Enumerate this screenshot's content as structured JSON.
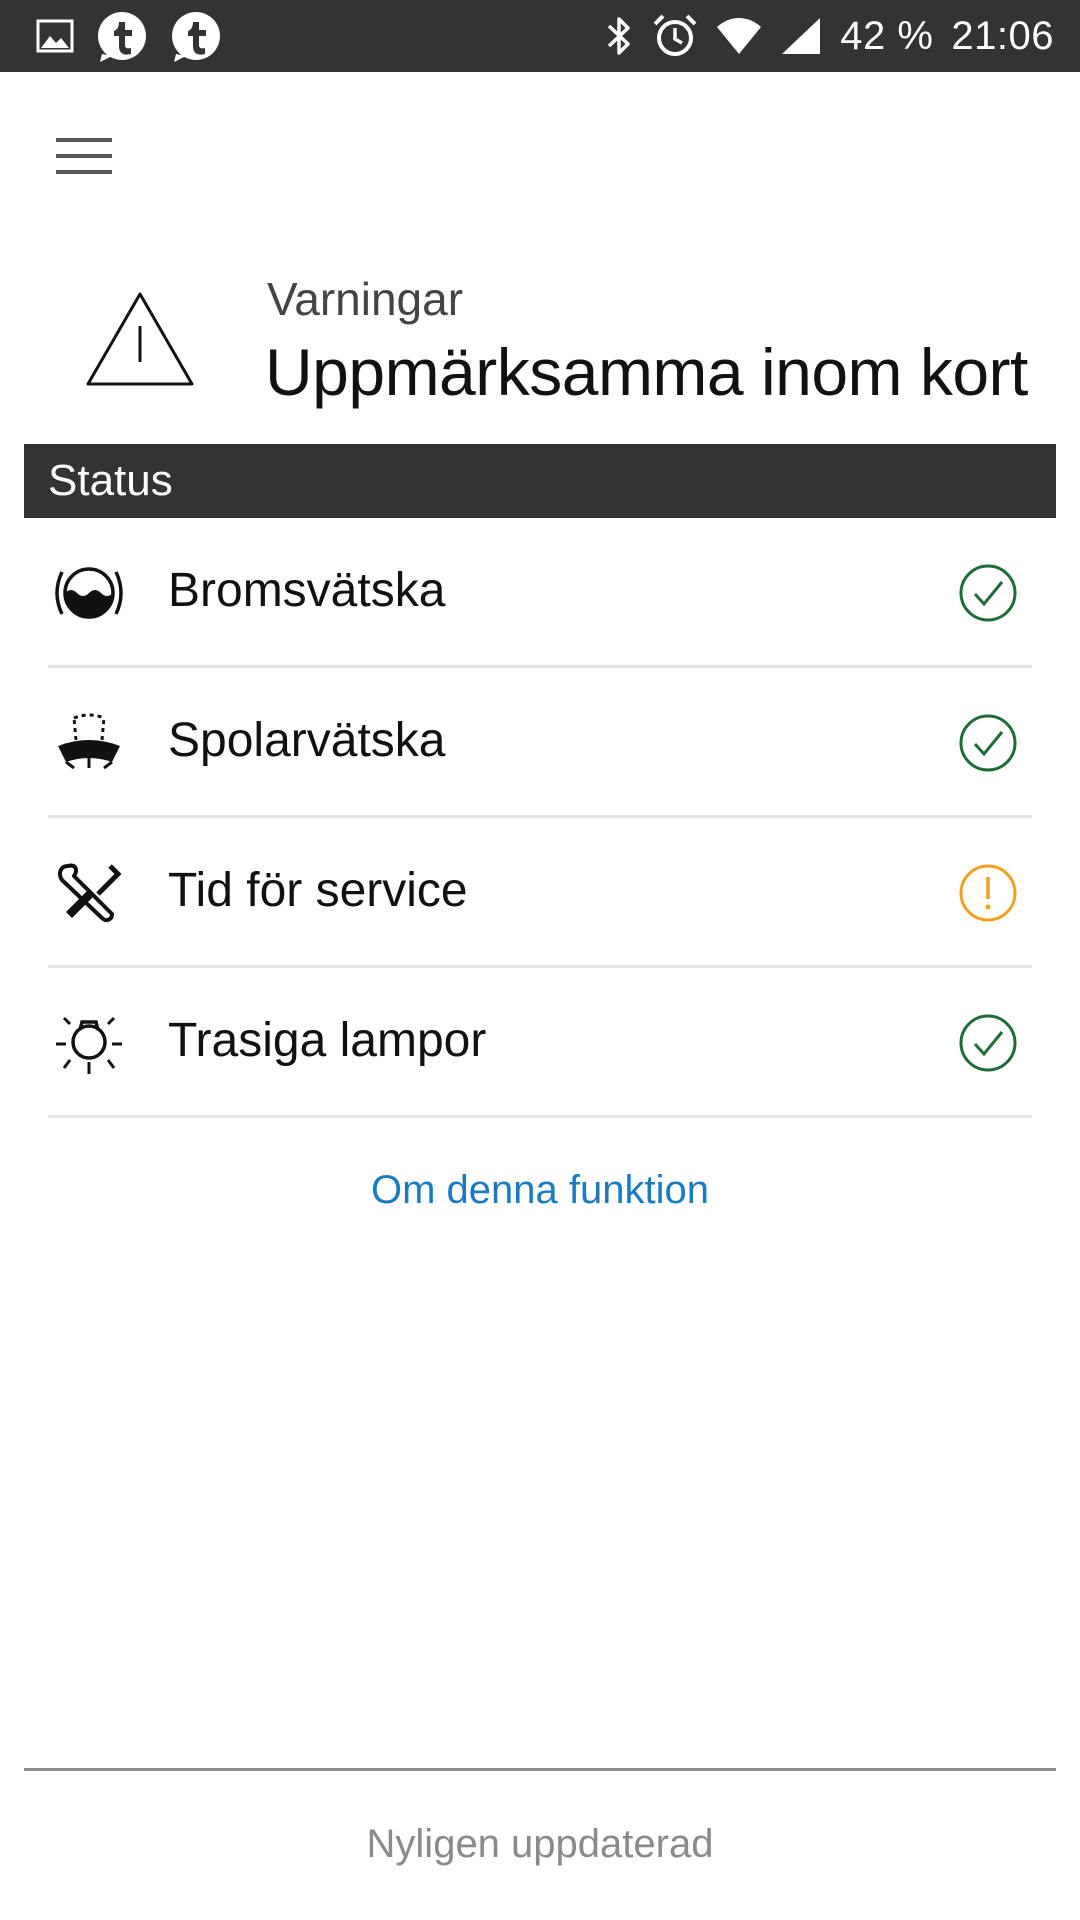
{
  "status_bar": {
    "left_icons": [
      "image-icon",
      "tumblr-notification-icon",
      "tumblr-notification-icon"
    ],
    "right_icons": [
      "bluetooth-icon",
      "alarm-icon",
      "wifi-icon",
      "cellular-signal-icon"
    ],
    "battery": "42 %",
    "time": "21:06"
  },
  "menu": {
    "icon": "hamburger-menu-icon"
  },
  "header": {
    "icon": "warning-triangle-icon",
    "subtitle": "Varningar",
    "title": "Uppmärksamma inom kort"
  },
  "section": {
    "label": "Status"
  },
  "status_items": [
    {
      "label": "Bromsvätska",
      "icon": "brake-fluid-icon",
      "status": "ok",
      "status_icon": "check-circle-icon"
    },
    {
      "label": "Spolarvätska",
      "icon": "washer-fluid-icon",
      "status": "ok",
      "status_icon": "check-circle-icon"
    },
    {
      "label": "Tid för service",
      "icon": "service-tools-icon",
      "status": "warning",
      "status_icon": "exclamation-circle-icon"
    },
    {
      "label": "Trasiga lampor",
      "icon": "bulb-icon",
      "status": "ok",
      "status_icon": "check-circle-icon"
    }
  ],
  "link": {
    "label": "Om denna funktion"
  },
  "footer": {
    "text": "Nyligen uppdaterad"
  },
  "colors": {
    "bar_background": "#333333",
    "ok": "#1f6b3a",
    "warning": "#f0a020",
    "link": "#1b7bc1",
    "footer_text": "#8a8a8a"
  }
}
